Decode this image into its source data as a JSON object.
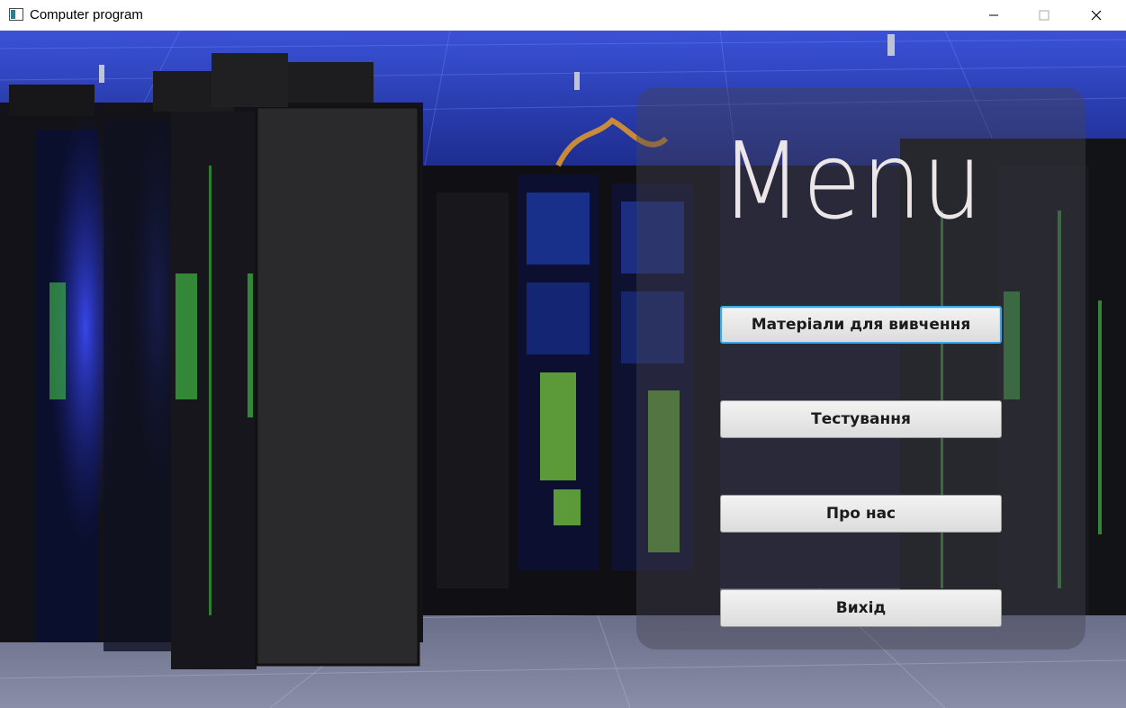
{
  "window": {
    "title": "Computer program",
    "icon": "app-window-icon",
    "controls": [
      "minimize-icon",
      "maximize-icon",
      "close-icon"
    ]
  },
  "background": {
    "scene": "server-room"
  },
  "menu": {
    "title": "Menu",
    "buttons": [
      {
        "label": "Матеріали для вивчення",
        "focused": true
      },
      {
        "label": "Тестування"
      },
      {
        "label": "Про нас"
      },
      {
        "label": "Вихід"
      }
    ]
  },
  "colors": {
    "focus_ring": "#3fa7e0",
    "menu_title": "#ece6e8"
  }
}
